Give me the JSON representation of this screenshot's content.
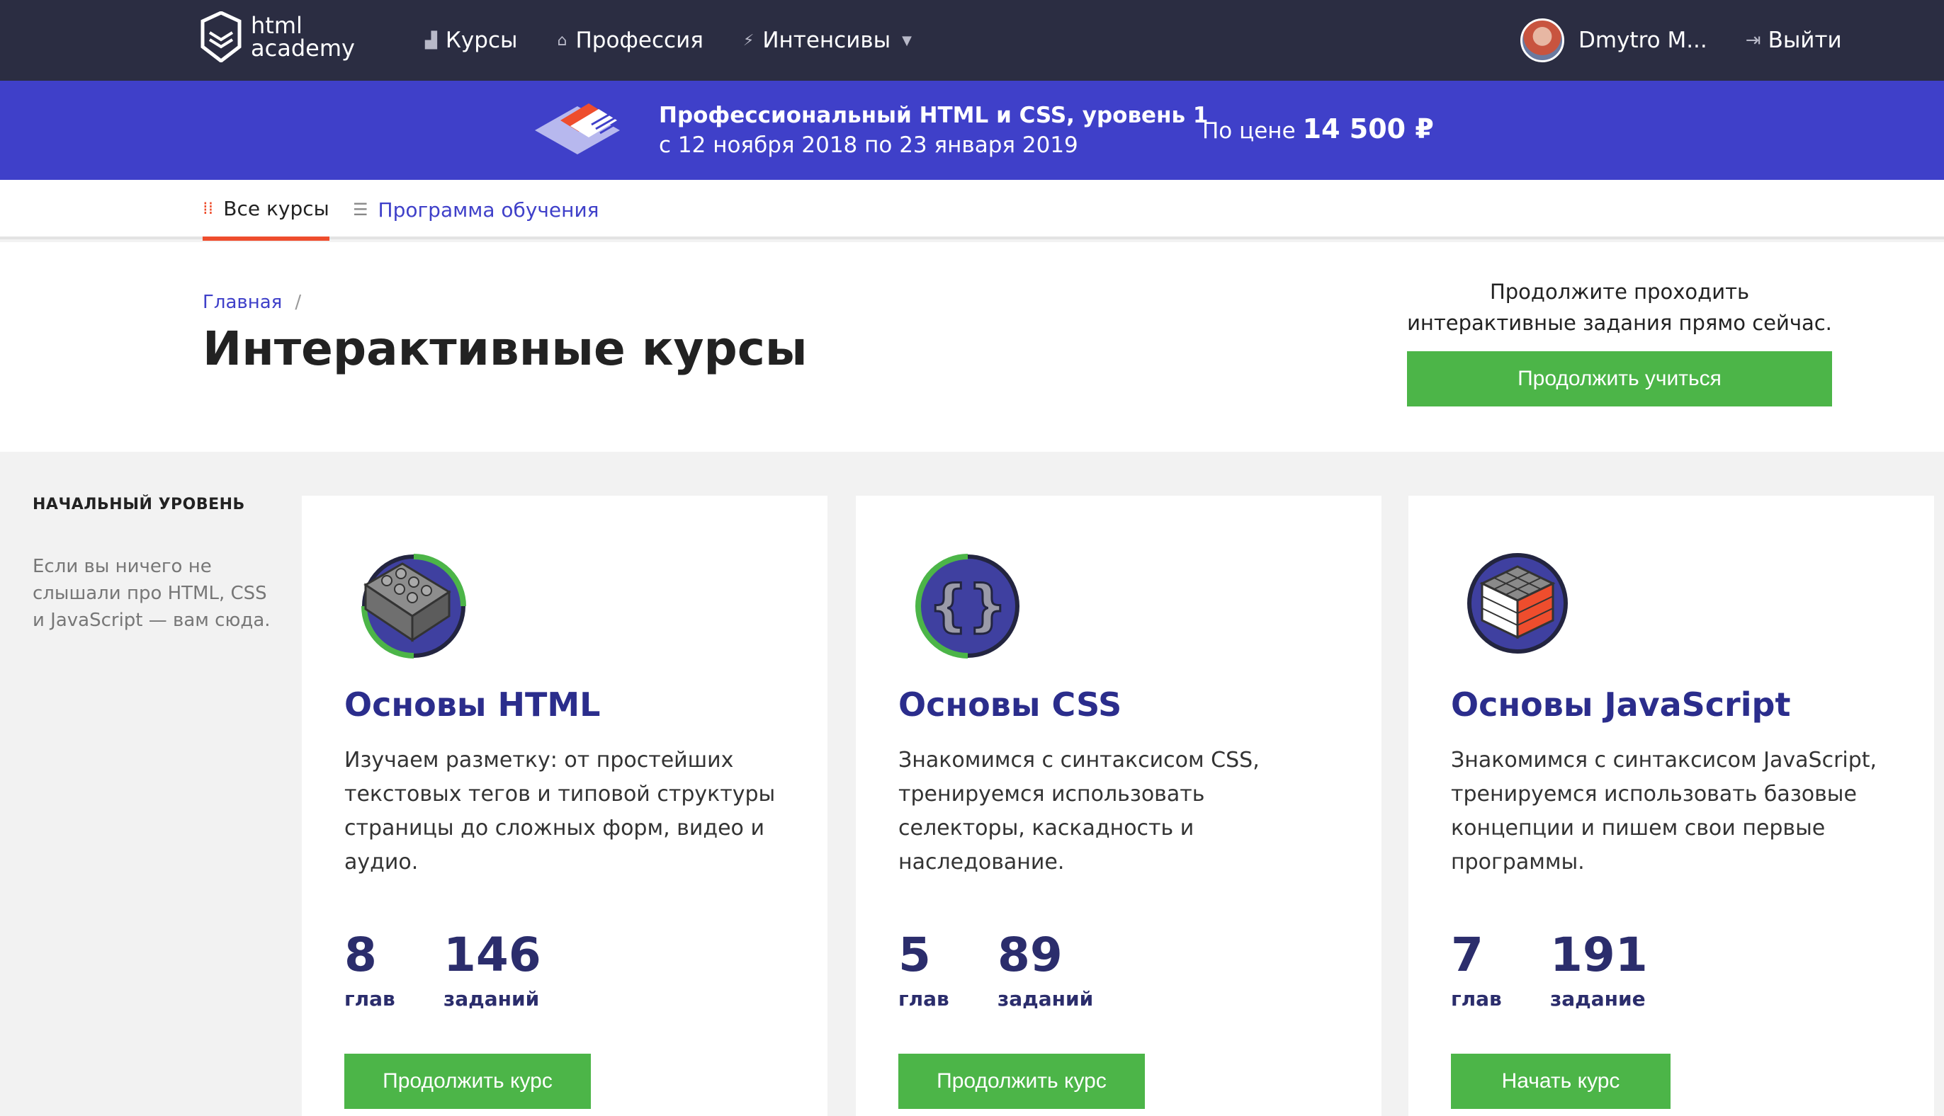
{
  "header": {
    "logo_line1": "html",
    "logo_line2": "academy",
    "nav": [
      {
        "label": "Курсы",
        "icon": "bar-chart-icon"
      },
      {
        "label": "Профессия",
        "icon": "graduation-cap-icon"
      },
      {
        "label": "Интенсивы",
        "icon": "lightning-icon"
      }
    ],
    "user_name": "Dmytro M...",
    "logout_label": "Выйти"
  },
  "promo": {
    "title": "Профессиональный HTML и CSS, уровень 1",
    "dates": "с 12 ноября 2018 по 23 января 2019",
    "price_prefix": "По цене",
    "price": "14 500 ₽"
  },
  "subnav": {
    "all_courses": "Все курсы",
    "program": "Программа обучения"
  },
  "hero": {
    "breadcrumb_home": "Главная",
    "breadcrumb_sep": "/",
    "title": "Интерактивные курсы",
    "cta_text": "Продолжите проходить интерактивные задания прямо сейчас.",
    "cta_button": "Продолжить учиться"
  },
  "sidebar": {
    "level_title": "НАЧАЛЬНЫЙ УРОВЕНЬ",
    "level_desc": "Если вы ничего не слышали про HTML, CSS и JavaScript — вам сюда."
  },
  "courses": [
    {
      "title": "Основы HTML",
      "description": "Изучаем разметку: от простейших текстовых тегов и типовой структуры страницы до сложных форм, видео и аудио.",
      "chapters": "8",
      "chapters_label": "глав",
      "tasks": "146",
      "tasks_label": "заданий",
      "button": "Продолжить курс",
      "icon": "lego-brick-icon"
    },
    {
      "title": "Основы CSS",
      "description": "Знакомимся с синтаксисом CSS, тренируемся использовать селекторы, каскадность и наследование.",
      "chapters": "5",
      "chapters_label": "глав",
      "tasks": "89",
      "tasks_label": "заданий",
      "button": "Продолжить курс",
      "icon": "curly-braces-icon"
    },
    {
      "title": "Основы JavaScript",
      "description": "Знакомимся с синтаксисом JavaScript, тренируемся использовать базовые концепции и пишем свои первые программы.",
      "chapters": "7",
      "chapters_label": "глав",
      "tasks": "191",
      "tasks_label": "задание",
      "button": "Начать курс",
      "icon": "rubik-cube-icon"
    }
  ],
  "colors": {
    "topbar": "#2b2d42",
    "promo": "#3f40c9",
    "accent_green": "#4cb548",
    "accent_orange": "#ee4d2d",
    "title_blue": "#2b2d8c"
  }
}
